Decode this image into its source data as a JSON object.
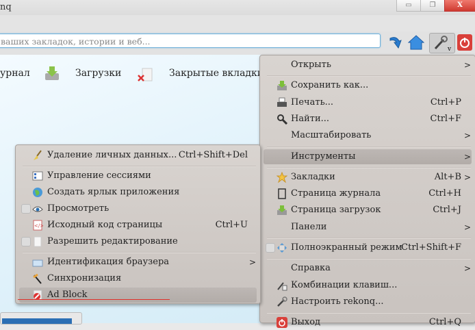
{
  "window": {
    "title": "nq",
    "minimize_icon": "minimize-icon",
    "restore_icon": "restore-icon",
    "close_icon": "close-icon"
  },
  "toolbar": {
    "url_placeholder": "ваших закладок, истории и веб...",
    "reload_icon": "reload-icon",
    "home_icon": "home-icon",
    "tools_icon": "wrench-icon",
    "power_icon": "power-icon"
  },
  "content": {
    "links": [
      "урнал",
      "Загрузки",
      "Закрытые вкладки"
    ]
  },
  "main_menu": {
    "items": [
      {
        "label": "Открыть",
        "shortcut": "",
        "submenu": true,
        "icon": ""
      },
      {
        "sep": true
      },
      {
        "label": "Сохранить как...",
        "shortcut": "",
        "icon": "save-icon"
      },
      {
        "label": "Печать...",
        "shortcut": "Ctrl+P",
        "icon": "print-icon"
      },
      {
        "label": "Найти...",
        "shortcut": "Ctrl+F",
        "icon": "search-icon"
      },
      {
        "label": "Масштабировать",
        "shortcut": "",
        "submenu": true,
        "icon": ""
      },
      {
        "sep": true
      },
      {
        "label": "Инструменты",
        "shortcut": "",
        "submenu": true,
        "icon": "",
        "highlight": true
      },
      {
        "sep": true
      },
      {
        "label": "Закладки",
        "shortcut": "Alt+B",
        "submenu": true,
        "icon": "star-icon"
      },
      {
        "label": "Страница журнала",
        "shortcut": "Ctrl+H",
        "icon": "history-icon"
      },
      {
        "label": "Страница загрузок",
        "shortcut": "Ctrl+J",
        "icon": "download-icon"
      },
      {
        "label": "Панели",
        "shortcut": "",
        "submenu": true,
        "icon": ""
      },
      {
        "sep": true
      },
      {
        "label": "Полноэкранный режим",
        "shortcut": "Ctrl+Shift+F",
        "icon": "fullscreen-icon",
        "checkbox": true
      },
      {
        "sep": true
      },
      {
        "label": "Справка",
        "shortcut": "",
        "submenu": true,
        "icon": ""
      },
      {
        "label": "Комбинации клавиш...",
        "shortcut": "",
        "icon": "keyboard-shortcuts-icon"
      },
      {
        "label": "Настроить rekonq...",
        "shortcut": "",
        "icon": "configure-icon"
      },
      {
        "sep": true
      },
      {
        "label": "Выход",
        "shortcut": "Ctrl+Q",
        "icon": "power-icon"
      }
    ]
  },
  "tools_menu": {
    "items": [
      {
        "label": "Удаление личных данных...",
        "shortcut": "Ctrl+Shift+Del",
        "icon": "broom-icon"
      },
      {
        "sep": true
      },
      {
        "label": "Управление сессиями",
        "shortcut": "",
        "icon": "sessions-icon"
      },
      {
        "label": "Создать ярлык приложения",
        "shortcut": "",
        "icon": "globe-icon"
      },
      {
        "label": "Просмотреть",
        "shortcut": "",
        "icon": "eye-icon",
        "checkbox": true
      },
      {
        "label": "Исходный код страницы",
        "shortcut": "Ctrl+U",
        "icon": "source-code-icon"
      },
      {
        "label": "Разрешить редактирование",
        "shortcut": "",
        "icon": "document-icon",
        "checkbox": true
      },
      {
        "sep": true
      },
      {
        "label": "Идентификация браузера",
        "shortcut": "",
        "submenu": true,
        "icon": "user-agent-icon"
      },
      {
        "label": "Синхронизация",
        "shortcut": "",
        "icon": "sync-icon"
      },
      {
        "label": "Ad Block",
        "shortcut": "",
        "icon": "adblock-icon",
        "highlight": true
      }
    ]
  },
  "colors": {
    "accent": "#2b8be0",
    "close_red": "#d9403a",
    "menu_bg": "#cdc7c3"
  }
}
